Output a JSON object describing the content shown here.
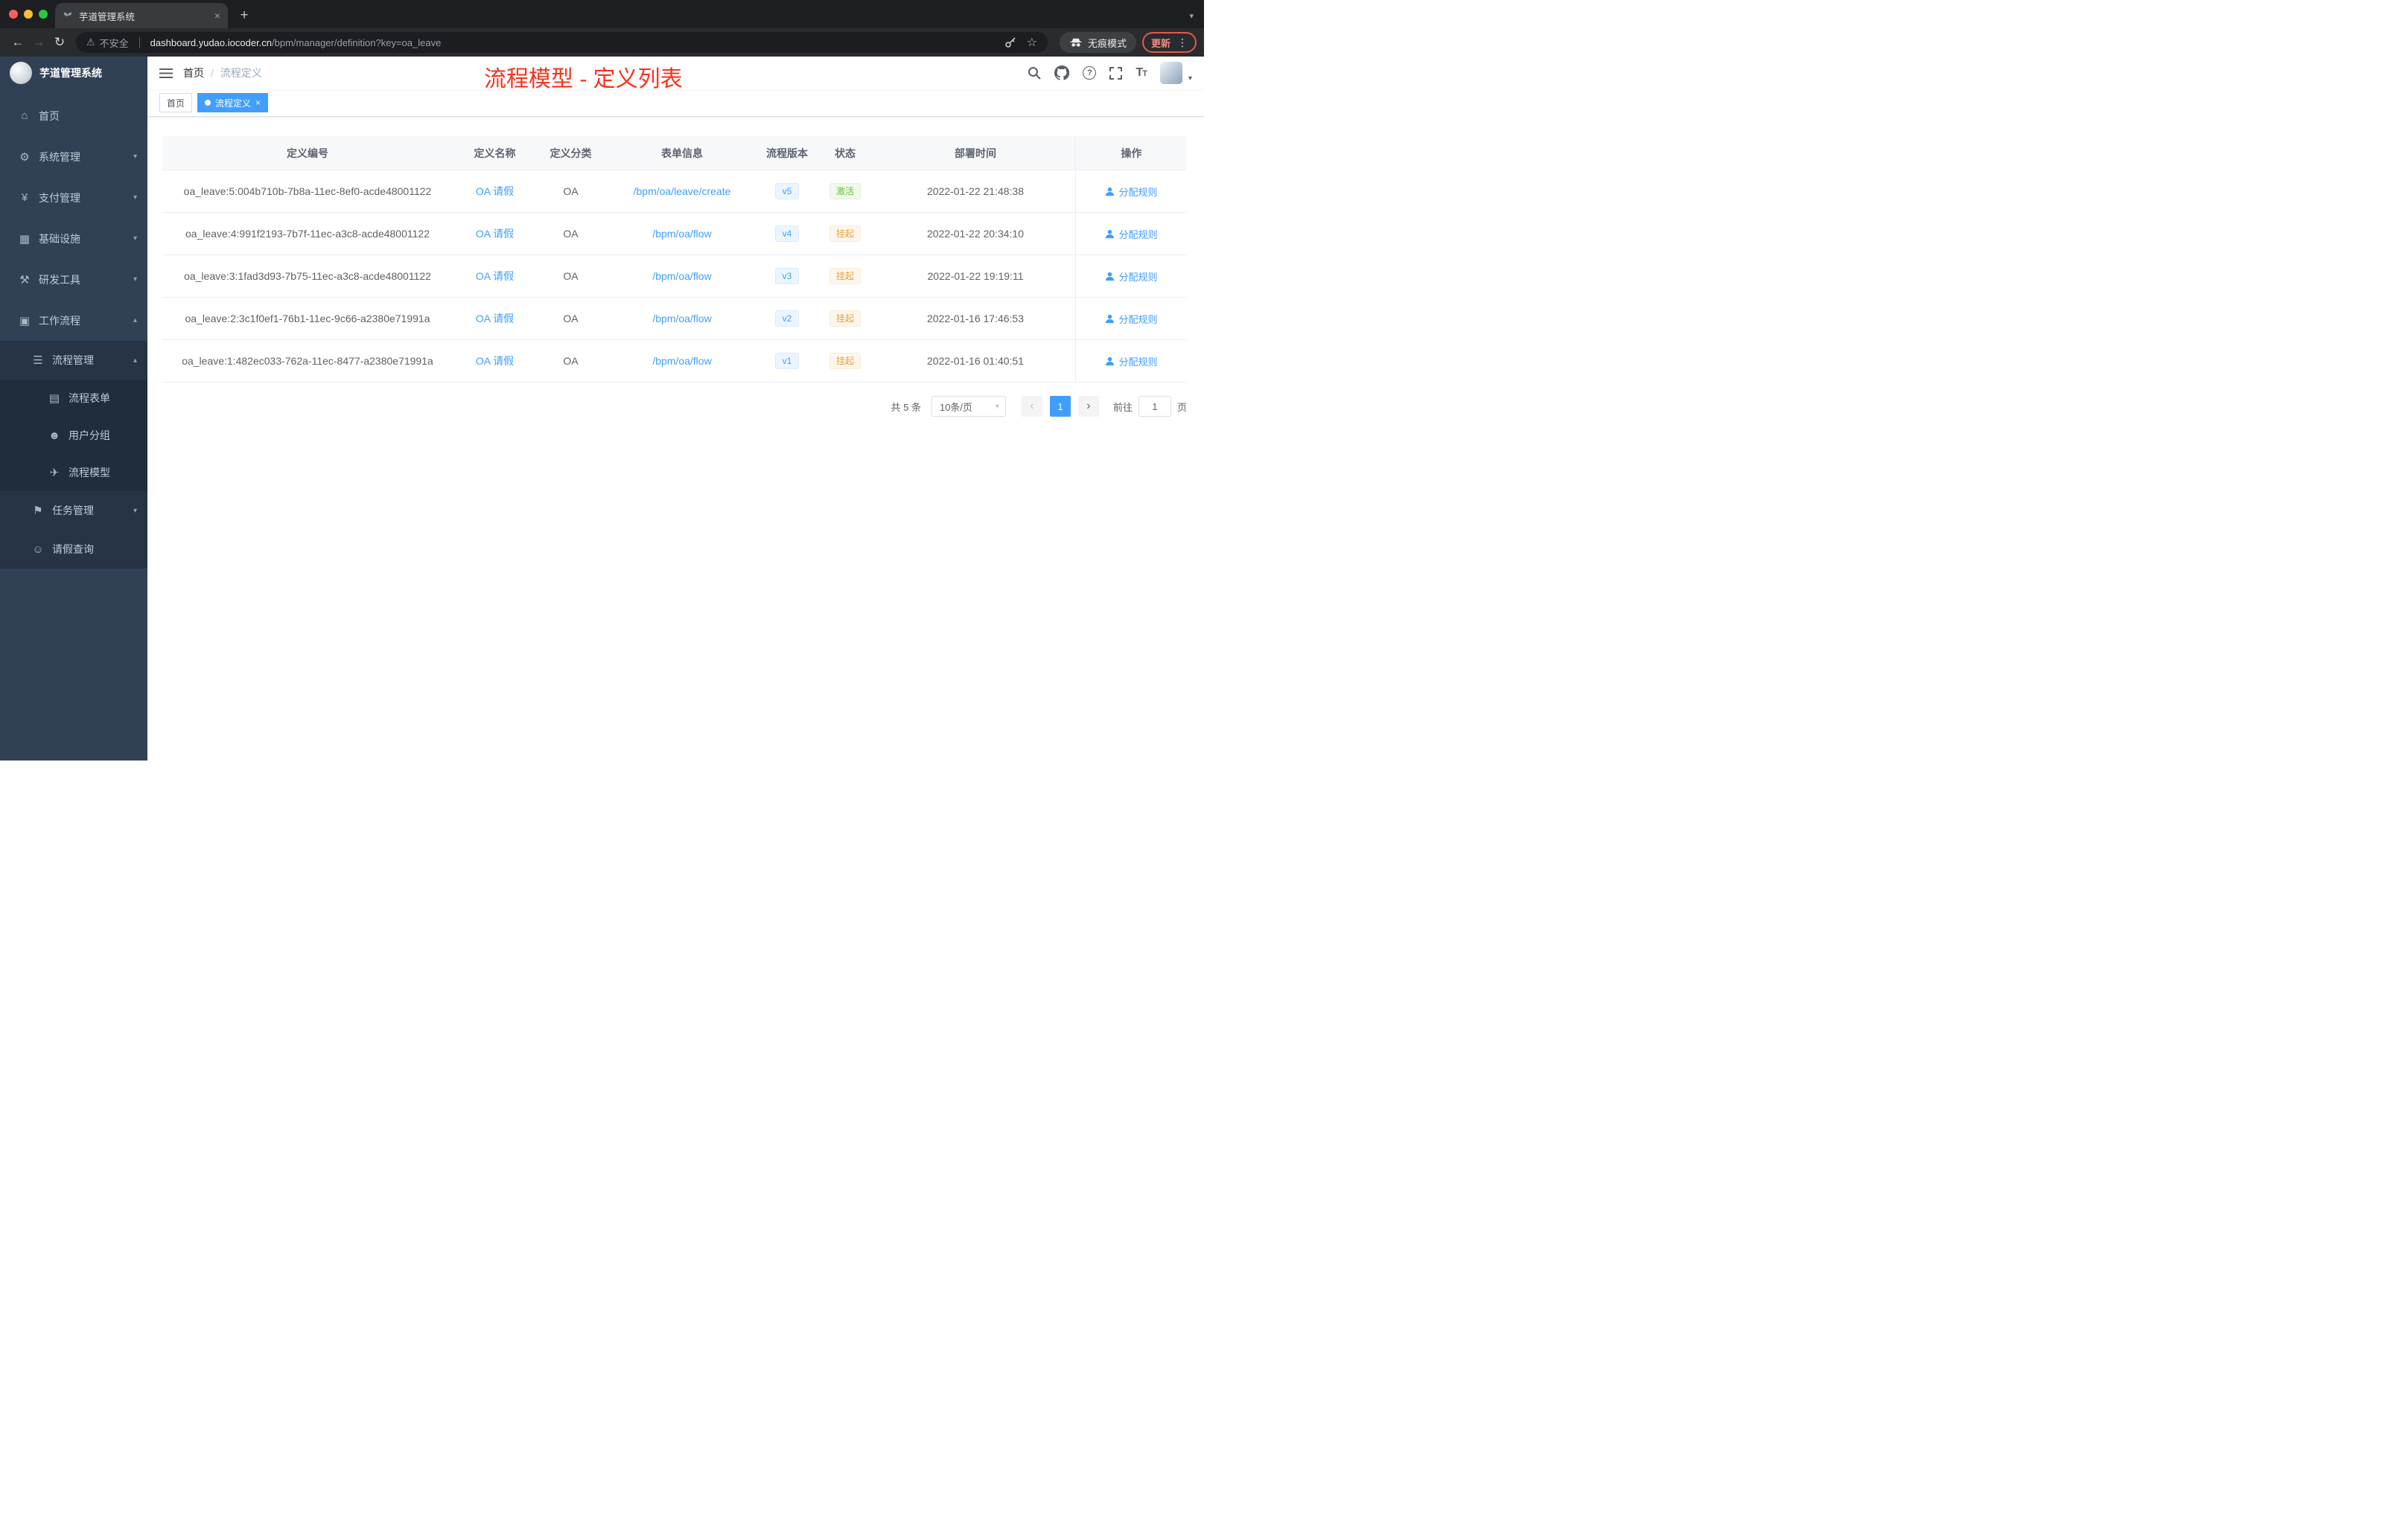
{
  "browser": {
    "tab": {
      "title": "芋道管理系统",
      "close": "×",
      "new_tab": "+"
    },
    "toolbar": {
      "security_label": "不安全",
      "url_host": "dashboard.yudao.iocoder.cn",
      "url_path": "/bpm/manager/definition?key=oa_leave",
      "incognito_label": "无痕模式",
      "update_label": "更新"
    }
  },
  "sidebar": {
    "logo_title": "芋道管理系统",
    "items": [
      {
        "label": "首页"
      },
      {
        "label": "系统管理"
      },
      {
        "label": "支付管理"
      },
      {
        "label": "基础设施"
      },
      {
        "label": "研发工具"
      },
      {
        "label": "工作流程"
      },
      {
        "label": "流程管理"
      },
      {
        "label": "流程表单"
      },
      {
        "label": "用户分组"
      },
      {
        "label": "流程模型"
      },
      {
        "label": "任务管理"
      },
      {
        "label": "请假查询"
      }
    ]
  },
  "header": {
    "breadcrumb": [
      "首页",
      "流程定义"
    ],
    "separator": "/",
    "annotation": "流程模型 - 定义列表"
  },
  "tags": {
    "home": "首页",
    "active": "流程定义",
    "close": "×"
  },
  "table": {
    "columns": [
      "定义编号",
      "定义名称",
      "定义分类",
      "表单信息",
      "流程版本",
      "状态",
      "部署时间",
      "操作"
    ],
    "rows": [
      {
        "id": "oa_leave:5:004b710b-7b8a-11ec-8ef0-acde48001122",
        "name": "OA 请假",
        "category": "OA",
        "form": "/bpm/oa/leave/create",
        "version": "v5",
        "status": "激活",
        "status_type": "active",
        "deployed": "2022-01-22 21:48:38",
        "action": "分配规则"
      },
      {
        "id": "oa_leave:4:991f2193-7b7f-11ec-a3c8-acde48001122",
        "name": "OA 请假",
        "category": "OA",
        "form": "/bpm/oa/flow",
        "version": "v4",
        "status": "挂起",
        "status_type": "suspended",
        "deployed": "2022-01-22 20:34:10",
        "action": "分配规则"
      },
      {
        "id": "oa_leave:3:1fad3d93-7b75-11ec-a3c8-acde48001122",
        "name": "OA 请假",
        "category": "OA",
        "form": "/bpm/oa/flow",
        "version": "v3",
        "status": "挂起",
        "status_type": "suspended",
        "deployed": "2022-01-22 19:19:11",
        "action": "分配规则"
      },
      {
        "id": "oa_leave:2:3c1f0ef1-76b1-11ec-9c66-a2380e71991a",
        "name": "OA 请假",
        "category": "OA",
        "form": "/bpm/oa/flow",
        "version": "v2",
        "status": "挂起",
        "status_type": "suspended",
        "deployed": "2022-01-16 17:46:53",
        "action": "分配规则"
      },
      {
        "id": "oa_leave:1:482ec033-762a-11ec-8477-a2380e71991a",
        "name": "OA 请假",
        "category": "OA",
        "form": "/bpm/oa/flow",
        "version": "v1",
        "status": "挂起",
        "status_type": "suspended",
        "deployed": "2022-01-16 01:40:51",
        "action": "分配规则"
      }
    ]
  },
  "pagination": {
    "total": "共 5 条",
    "page_size": "10条/页",
    "prev": "‹",
    "next": "›",
    "page": "1",
    "goto": "前往",
    "goto_value": "1",
    "unit": "页"
  },
  "colors": {
    "accent": "#409eff",
    "success": "#67c23a",
    "warning": "#e6a23c",
    "annotation_red": "#f7321c",
    "sidebar_bg": "#304156",
    "submenu_bg": "#1f2d3d"
  }
}
